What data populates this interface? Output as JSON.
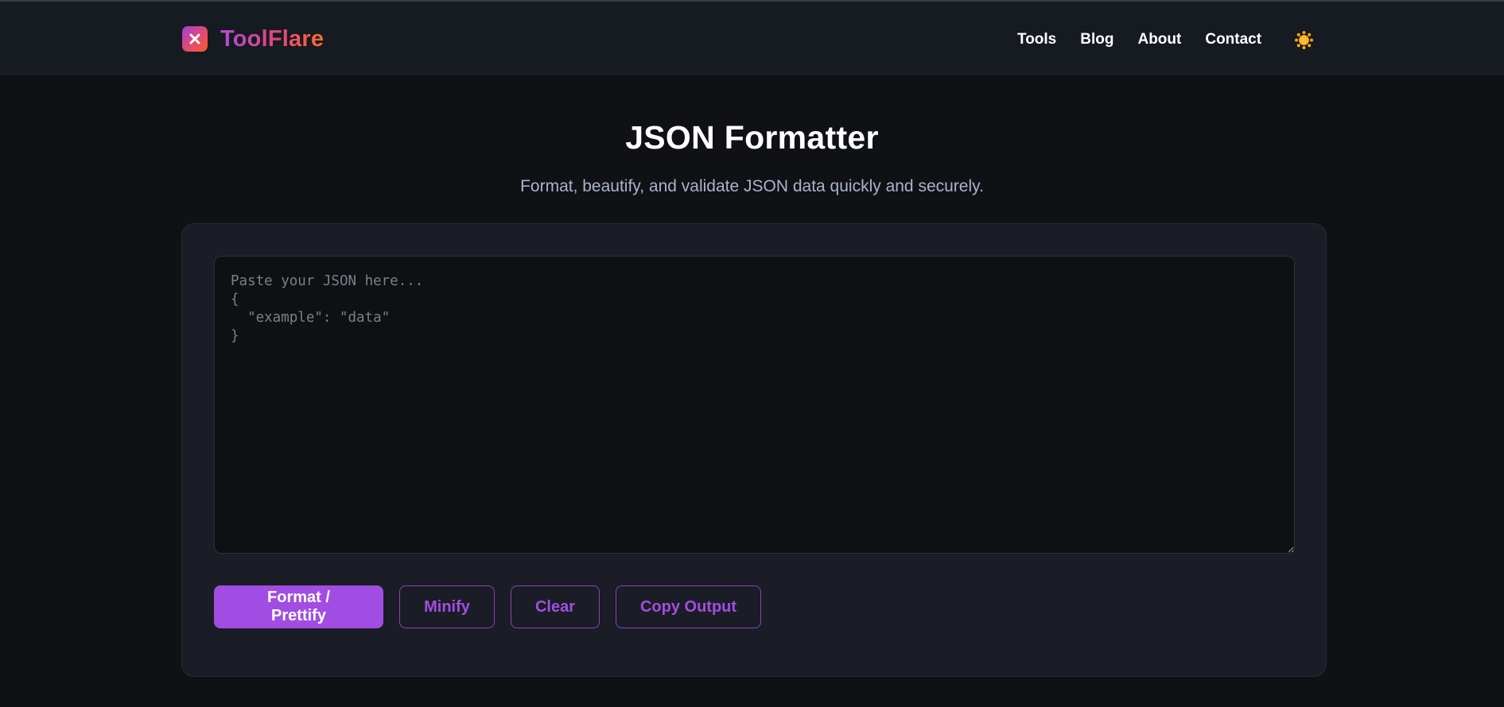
{
  "brand": {
    "name": "ToolFlare"
  },
  "nav": {
    "items": [
      "Tools",
      "Blog",
      "About",
      "Contact"
    ]
  },
  "theme_toggle": {
    "icon": "sun-icon"
  },
  "page": {
    "title": "JSON Formatter",
    "subtitle": "Format, beautify, and validate JSON data quickly and securely."
  },
  "editor": {
    "value": "",
    "placeholder": "Paste your JSON here...\n{\n  \"example\": \"data\"\n}"
  },
  "actions": {
    "format_label": "Format / Prettify",
    "minify_label": "Minify",
    "clear_label": "Clear",
    "copy_label": "Copy Output"
  },
  "colors": {
    "accent": "#a14de3",
    "page_bg": "#0f1115",
    "header_bg": "#161a21",
    "card_bg": "#1a1d25",
    "subtitle": "#a9b4cc",
    "sun": "#f5a623"
  }
}
